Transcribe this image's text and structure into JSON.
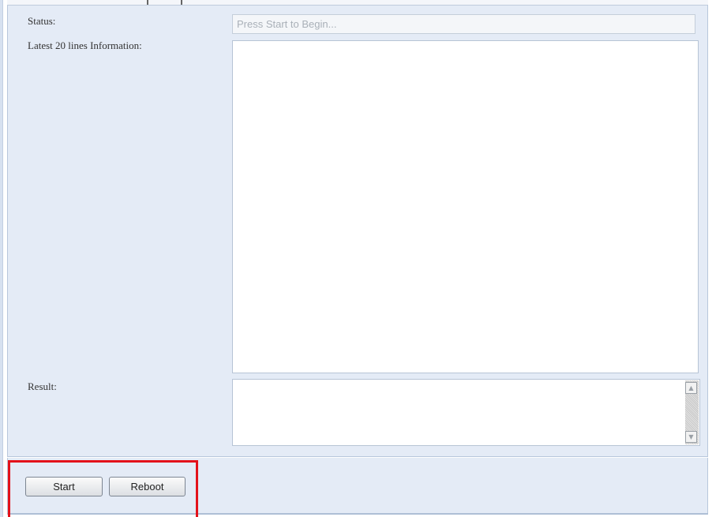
{
  "form": {
    "status_label": "Status:",
    "status_placeholder": "Press Start to Begin...",
    "info_label": "Latest 20 lines Information:",
    "info_value": "",
    "result_label": "Result:",
    "result_value": ""
  },
  "actions": {
    "start_label": "Start",
    "reboot_label": "Reboot"
  },
  "icons": {
    "scroll_up": "scroll-up-arrow-icon",
    "scroll_down": "scroll-down-arrow-icon"
  },
  "colors": {
    "panel_bg": "#e4ebf6",
    "highlight": "#e3121b"
  }
}
